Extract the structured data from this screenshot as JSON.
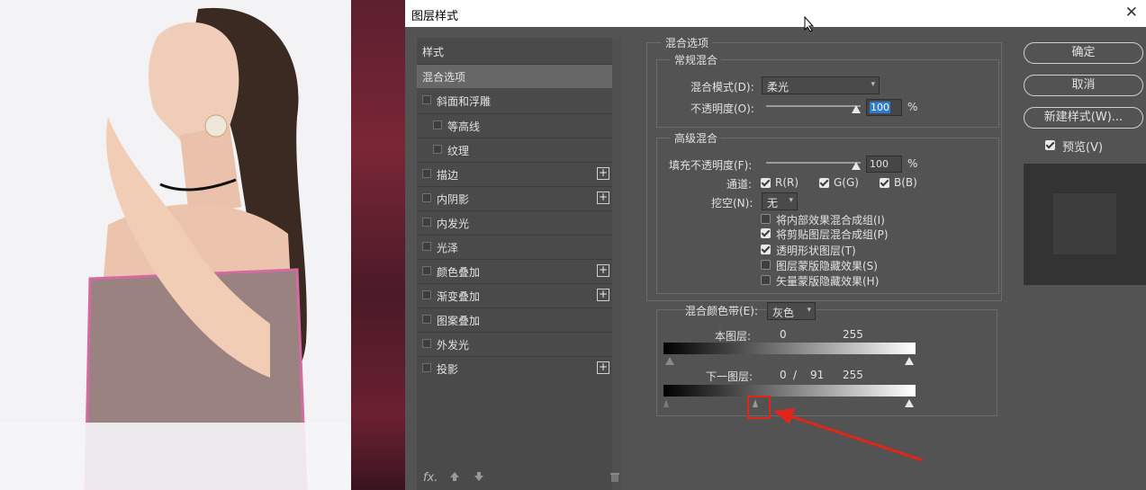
{
  "window": {
    "title": "图层样式"
  },
  "left_panel": {
    "header": "样式",
    "items": [
      {
        "label": "混合选项",
        "checkbox": false,
        "plus": false,
        "active": true
      },
      {
        "label": "斜面和浮雕",
        "checkbox": true,
        "plus": false
      },
      {
        "label": "等高线",
        "checkbox": true,
        "plus": false,
        "indent": true
      },
      {
        "label": "纹理",
        "checkbox": true,
        "plus": false,
        "indent": true
      },
      {
        "label": "描边",
        "checkbox": true,
        "plus": true
      },
      {
        "label": "内阴影",
        "checkbox": true,
        "plus": true
      },
      {
        "label": "内发光",
        "checkbox": true,
        "plus": false
      },
      {
        "label": "光泽",
        "checkbox": true,
        "plus": false
      },
      {
        "label": "颜色叠加",
        "checkbox": true,
        "plus": true
      },
      {
        "label": "渐变叠加",
        "checkbox": true,
        "plus": true
      },
      {
        "label": "图案叠加",
        "checkbox": true,
        "plus": false
      },
      {
        "label": "外发光",
        "checkbox": true,
        "plus": false
      },
      {
        "label": "投影",
        "checkbox": true,
        "plus": true
      }
    ],
    "plus_symbol": "+",
    "footer": {
      "fx": "fx."
    }
  },
  "blend": {
    "section_title": "混合选项",
    "general": {
      "title": "常规混合",
      "mode_label": "混合模式(D):",
      "mode_value": "柔光",
      "opacity_label": "不透明度(O):",
      "opacity_value": "100",
      "opacity_unit": "%"
    },
    "advanced": {
      "title": "高级混合",
      "fill_label": "填充不透明度(F):",
      "fill_value": "100",
      "fill_unit": "%",
      "channels_label": "通道:",
      "channels": [
        {
          "label": "R(R)",
          "checked": true
        },
        {
          "label": "G(G)",
          "checked": true
        },
        {
          "label": "B(B)",
          "checked": true
        }
      ],
      "knockout_label": "挖空(N):",
      "knockout_value": "无",
      "options": [
        {
          "label": "将内部效果混合成组(I)",
          "checked": false
        },
        {
          "label": "将剪贴图层混合成组(P)",
          "checked": true
        },
        {
          "label": "透明形状图层(T)",
          "checked": true
        },
        {
          "label": "图层蒙版隐藏效果(S)",
          "checked": false
        },
        {
          "label": "矢量蒙版隐藏效果(H)",
          "checked": false
        }
      ]
    },
    "blend_if": {
      "label": "混合颜色带(E):",
      "value": "灰色",
      "this_layer_label": "本图层:",
      "this_layer_low": "0",
      "this_layer_high": "255",
      "under_layer_label": "下一图层:",
      "under_layer_low": "0",
      "under_layer_sep": "/",
      "under_layer_split": "91",
      "under_layer_high": "255"
    }
  },
  "buttons": {
    "ok": "确定",
    "cancel": "取消",
    "new_style": "新建样式(W)...",
    "preview_label": "预览(V)",
    "preview_checked": true
  },
  "annotation": {
    "color": "#e1251b"
  }
}
